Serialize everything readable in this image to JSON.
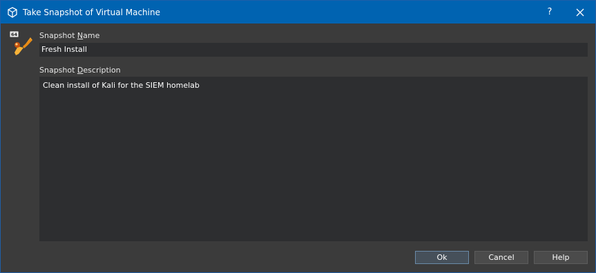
{
  "window": {
    "title": "Take Snapshot of Virtual Machine",
    "help_glyph": "?",
    "title_icon": "virtualbox-cube-icon",
    "close_icon": "close-icon"
  },
  "logo": {
    "icon": "virtualbox-64bit-logo-icon",
    "badge_text": "64"
  },
  "form": {
    "name_label_pre": "Snapshot ",
    "name_label_accel": "N",
    "name_label_post": "ame",
    "name_value": "Fresh Install",
    "desc_label_pre": "Snapshot ",
    "desc_label_accel": "D",
    "desc_label_post": "escription",
    "desc_value": "Clean install of Kali for the SIEM homelab"
  },
  "buttons": {
    "ok": "Ok",
    "cancel": "Cancel",
    "help": "Help"
  },
  "colors": {
    "titlebar": "#0063b1",
    "background": "#3b3b3b",
    "field": "#2d2e30",
    "text": "#ffffff"
  }
}
